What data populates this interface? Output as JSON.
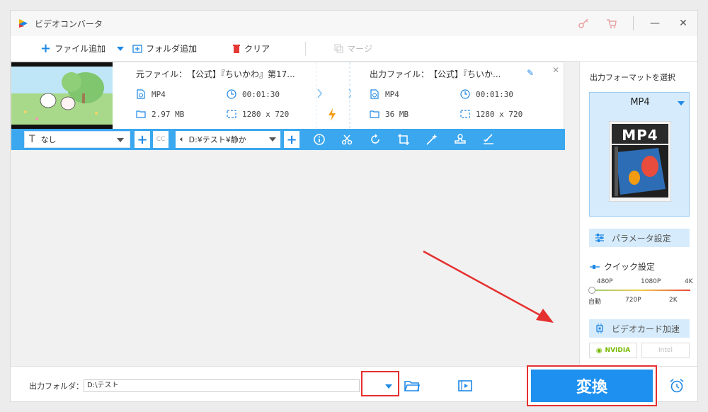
{
  "window": {
    "title": "ビデオコンバータ",
    "minimize": "—",
    "close": "✕"
  },
  "toolbar": {
    "add_file": "ファイル追加",
    "add_folder": "フォルダ追加",
    "clear": "クリア",
    "merge": "マージ"
  },
  "file": {
    "source_title": "元ファイル：　【公式】『ちいかわ』第17...",
    "source_format": "MP4",
    "source_duration": "00:01:30",
    "source_size": "2.97 MB",
    "source_resolution": "1280 x 720",
    "output_title": "出力ファイル：　【公式】『ちいか...",
    "output_format": "MP4",
    "output_duration": "00:01:30",
    "output_size": "36 MB",
    "output_resolution": "1280 x 720"
  },
  "editbar": {
    "subtitle_value": "なし",
    "audio_value": "D:¥テスト¥静か"
  },
  "right_panel": {
    "format_label": "出力フォーマットを選択",
    "format_name": "MP4",
    "format_icon_text": "MP4",
    "param_button": "パラメータ設定",
    "quick_label": "クイック設定",
    "slider_top": [
      "480P",
      "1080P",
      "4K"
    ],
    "slider_bottom": [
      "自動",
      "720P",
      "2K"
    ],
    "gpu_button": "ビデオカード加速",
    "nvidia": "NVIDIA",
    "intel": "Intel"
  },
  "bottom": {
    "output_label": "出力フォルダ：",
    "output_path": "D:\\テスト",
    "convert": "変換"
  },
  "colors": {
    "accent": "#1e90ef",
    "editbar": "#3ba7ef",
    "highlight": "#e53030"
  }
}
